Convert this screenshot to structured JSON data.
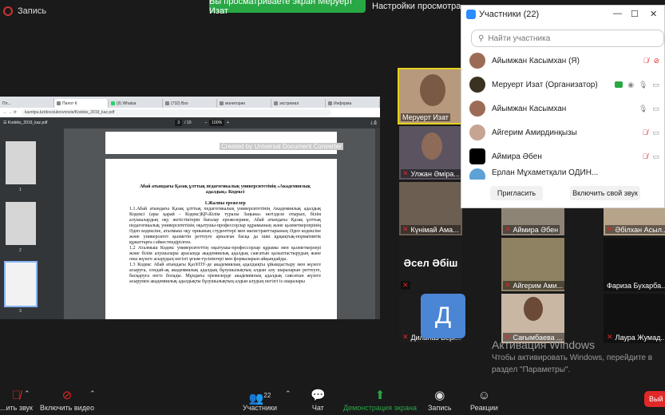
{
  "top": {
    "recording": "Запись",
    "viewing_banner": "Вы просматриваете экран Меруерт Изат",
    "view_settings": "Настройки просмотра"
  },
  "browser": {
    "tabs": [
      "Пл...",
      "Пилот К",
      "(9) Whatsa",
      "(732) Вхо",
      "мониторин",
      "экстремал",
      "Информа",
      "Информа",
      "Информа"
    ],
    "url": "kazntpu.kz/docs/ukrovnovie/Kodeks_2019_kaz.pdf",
    "pdf_file": "Kodeks_2019_kaz.pdf",
    "page_current": "3",
    "page_total": "/ 10",
    "zoom": "100%",
    "thumb_numbers": [
      "1",
      "2",
      "3"
    ],
    "watermark": "Created by Universal Document Converter",
    "doc_title": "Абай атындағы Қазақ ұлттық педагогикалық университетінің «Академиялық адалдық» Кодексі",
    "doc_section": "1.Жалпы ережелер",
    "doc_p1": "1.1.Абай атындағы Қазақ ұлттық педагогикалық университетінің Академиялық адалдық Кодексі (ары қарай - Кодекс)ҚР«Білім туралы Заңына» негізделе отырып, білім алушылардың оқу жетістіктерін бағалау ережелерине, Абай атындағы Қазақ ұлттық педагогикалық университетінің оқытушы-профессорлар құрамының және қызметкерлерінің Әдеп кодексіне, аталмыш оқу орнының студенттері мен магистранттарының Әдеп кодексіне және университет қызметін реттеуге арналған басқа да ішкі құқықтық-нормативтік құжаттарға сәйкестендірілген.",
    "doc_p2": "1.2 Аталмыш Кодекс университеттің оқытушы-профессорлар құрамы мен қызметкерлері және білім алушылары арасында академиялық адалдық саясатын қалыптастырудың және оны жүзеге асырудың негізгі ұғым-түсініктері мен формаларын айқындайды.",
    "doc_p3": "1.3 Кодекс Абай атындағы ҚазҰПУ-де академиялық адалдықты ұйымдастыру мен жүзеге асыруға, сондай-ақ академиялық адалдық бұзушылықтың алдын алу шараларын реттеуге, басқаруға негіз болады. Мұндағы ережелерде академиялық адалдық саясатын жүзеге асырумен академиялық адалдықты бұзушылықтың алдын алудың негізгі іс-шаралары"
  },
  "panel": {
    "title": "Участники (22)",
    "search_placeholder": "Найти участника",
    "participants": [
      {
        "name": "Айымжан Касымхан (Я)"
      },
      {
        "name": "Меруерт Изат (Организатор)"
      },
      {
        "name": "Айымжан Касымхан"
      },
      {
        "name": "Айгерим Амирдинқызы"
      },
      {
        "name": "Аймира Әбен"
      },
      {
        "name": "Ерлан Мұхаметқали ОДИН..."
      }
    ],
    "invite_button": "Пригласить",
    "unmute_button": "Включить свой звук"
  },
  "tiles": {
    "t1": "Меруерт Изат",
    "t2": "Улжан Әміра...",
    "t3": "Күнімай Ама...",
    "t4": "Аймира Әбен",
    "t5": "Әбілхан Асыл...",
    "t6_big": "Әсел Әбіш",
    "t7": "Айгерим Ами...",
    "t8": "Фариза Бухарба...",
    "t9": "Дильназ Бері...",
    "t9_letter": "Д",
    "t10": "Сағымбаева ...",
    "t11": "Лаура Жумад..."
  },
  "windows": {
    "title": "Активация Windows",
    "line1": "Чтобы активировать Windows, перейдите в",
    "line2": "раздел \"Параметры\"."
  },
  "toolbar": {
    "audio": "...ить звук",
    "video": "Включить видео",
    "participants_count": "22",
    "participants": "Участники",
    "chat": "Чат",
    "share": "Демонстрация экрана",
    "record": "Запись",
    "reactions": "Реакции",
    "end": "Вый"
  }
}
